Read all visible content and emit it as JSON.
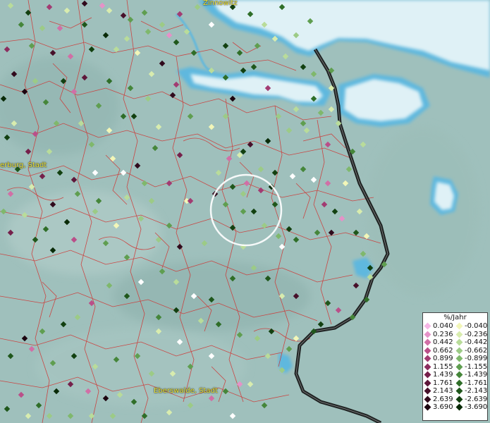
{
  "map": {
    "places": [
      {
        "id": "zinnowitz",
        "label": "Zinnowitz"
      },
      {
        "id": "eberswalde-left",
        "label": "erburg, Stadt"
      },
      {
        "id": "eberswalde",
        "label": "Eberswalde, Stadt"
      }
    ],
    "colors": {
      "land": "#9fc0bc",
      "water": "#dff1f6",
      "shore": "#5fb8de",
      "borders": "#d0312f",
      "national_border": "#111111",
      "highlight_circle": "#ffffff"
    }
  },
  "legend": {
    "title": "%/Jahr",
    "rows": [
      {
        "pos": "0.040",
        "pos_color": "#f5b6e6",
        "neg": "-0.040",
        "neg_color": "#f2f6b8"
      },
      {
        "pos": "0.236",
        "pos_color": "#e592c8",
        "neg": "-0.236",
        "neg_color": "#d8ecae"
      },
      {
        "pos": "0.442",
        "pos_color": "#d16fa6",
        "neg": "-0.442",
        "neg_color": "#b9dc9a"
      },
      {
        "pos": "0.662",
        "pos_color": "#ba4f89",
        "neg": "-0.662",
        "neg_color": "#9ccb86"
      },
      {
        "pos": "0.899",
        "pos_color": "#a23b72",
        "neg": "-0.899",
        "neg_color": "#7fb86c"
      },
      {
        "pos": "1.155",
        "pos_color": "#8c2c5e",
        "neg": "-1.155",
        "neg_color": "#5f9e50"
      },
      {
        "pos": "1.439",
        "pos_color": "#75204b",
        "neg": "-1.439",
        "neg_color": "#45863a"
      },
      {
        "pos": "1.761",
        "pos_color": "#5e173a",
        "neg": "-1.761",
        "neg_color": "#2f6e28"
      },
      {
        "pos": "2.143",
        "pos_color": "#47102a",
        "neg": "-2.143",
        "neg_color": "#1f571b"
      },
      {
        "pos": "2.639",
        "pos_color": "#300a1c",
        "neg": "-2.639",
        "neg_color": "#124010"
      },
      {
        "pos": "3.690",
        "pos_color": "#1c050f",
        "neg": "-3.690",
        "neg_color": "#082a07"
      }
    ]
  }
}
